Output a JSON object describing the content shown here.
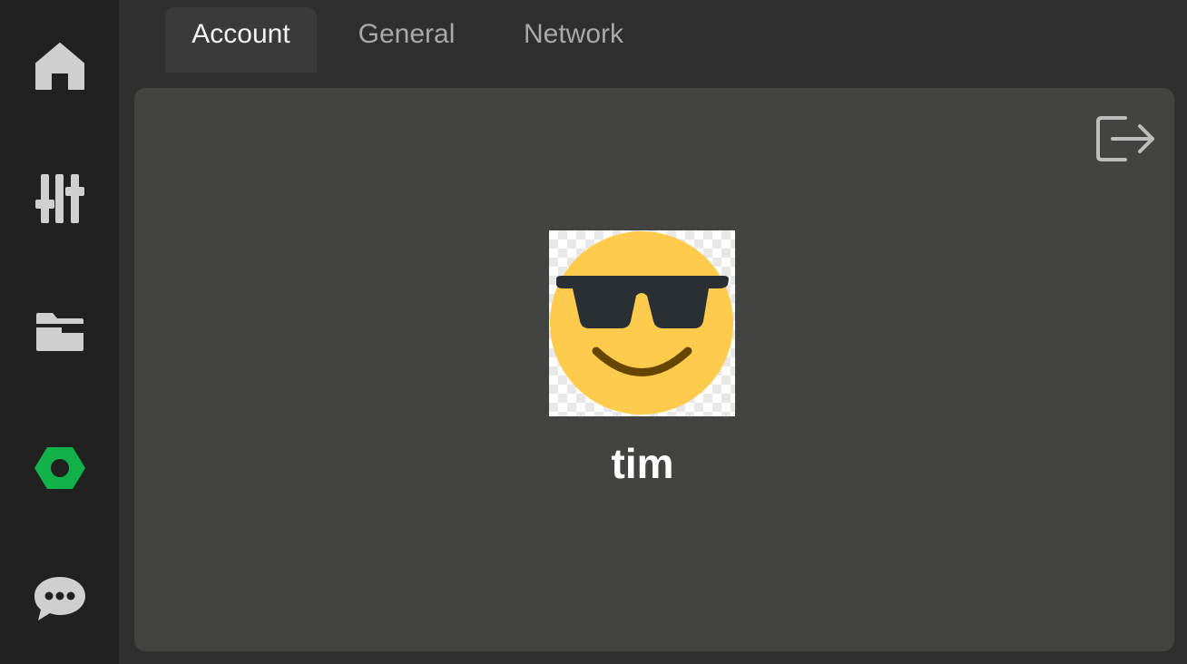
{
  "tabs": [
    {
      "label": "Account",
      "active": true
    },
    {
      "label": "General",
      "active": false
    },
    {
      "label": "Network",
      "active": false
    }
  ],
  "sidebar": {
    "items": [
      {
        "icon": "home-icon"
      },
      {
        "icon": "sliders-icon"
      },
      {
        "icon": "folder-icon"
      },
      {
        "icon": "hexagon-icon",
        "active": true
      },
      {
        "icon": "chat-icon"
      }
    ]
  },
  "account": {
    "username": "tim",
    "avatar": "sunglasses-emoji-avatar"
  },
  "colors": {
    "accent": "#12b24a",
    "sidebar_bg": "#212121",
    "panel_bg": "#434441",
    "icon_gray": "#cfcfcf"
  }
}
